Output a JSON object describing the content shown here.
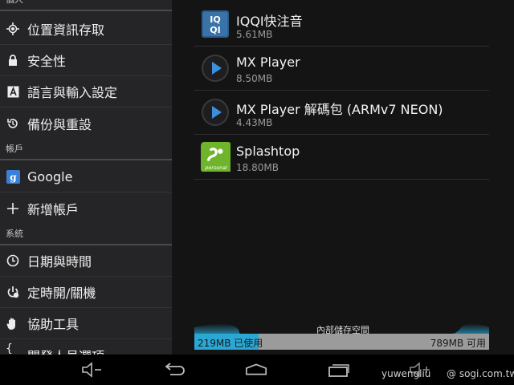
{
  "sidebar": {
    "header_personal": "個人",
    "items_personal": [
      {
        "label": "位置資訊存取",
        "icon": "location-icon"
      },
      {
        "label": "安全性",
        "icon": "lock-icon"
      },
      {
        "label": "語言與輸入設定",
        "icon": "keyboard-icon"
      },
      {
        "label": "備份與重設",
        "icon": "backup-icon"
      }
    ],
    "header_accounts": "帳戶",
    "items_accounts": [
      {
        "label": "Google",
        "icon": "google-icon"
      },
      {
        "label": "新增帳戶",
        "icon": "plus-icon"
      }
    ],
    "header_system": "系統",
    "items_system": [
      {
        "label": "日期與時間",
        "icon": "clock-icon"
      },
      {
        "label": "定時開/關機",
        "icon": "power-timer-icon"
      },
      {
        "label": "協助工具",
        "icon": "hand-icon"
      },
      {
        "label": "開發人員選項",
        "icon": "braces-icon"
      }
    ]
  },
  "apps": [
    {
      "name": "IQQI快注音",
      "size": "5.61MB",
      "icon": "iqqi-app-icon"
    },
    {
      "name": "MX Player",
      "size": "8.50MB",
      "icon": "mx-player-icon"
    },
    {
      "name": "MX Player 解碼包 (ARMv7 NEON)",
      "size": "4.43MB",
      "icon": "mx-player-codec-icon"
    },
    {
      "name": "Splashtop",
      "size": "18.80MB",
      "icon": "splashtop-icon"
    }
  ],
  "storage": {
    "label": "內部儲存空間",
    "used": "219MB 已使用",
    "available": "789MB 可用",
    "used_fraction": 0.217
  },
  "navbar": {
    "buttons": [
      "volume-down-icon",
      "back-icon",
      "home-icon",
      "recent-apps-icon",
      "volume-up-icon"
    ]
  },
  "watermark": {
    "user": "yuwengliu",
    "site": "@ sogi.com.tw"
  },
  "colors": {
    "accent": "#2aa7d3",
    "sidebar_bg": "#252527",
    "main_bg": "#141414"
  }
}
